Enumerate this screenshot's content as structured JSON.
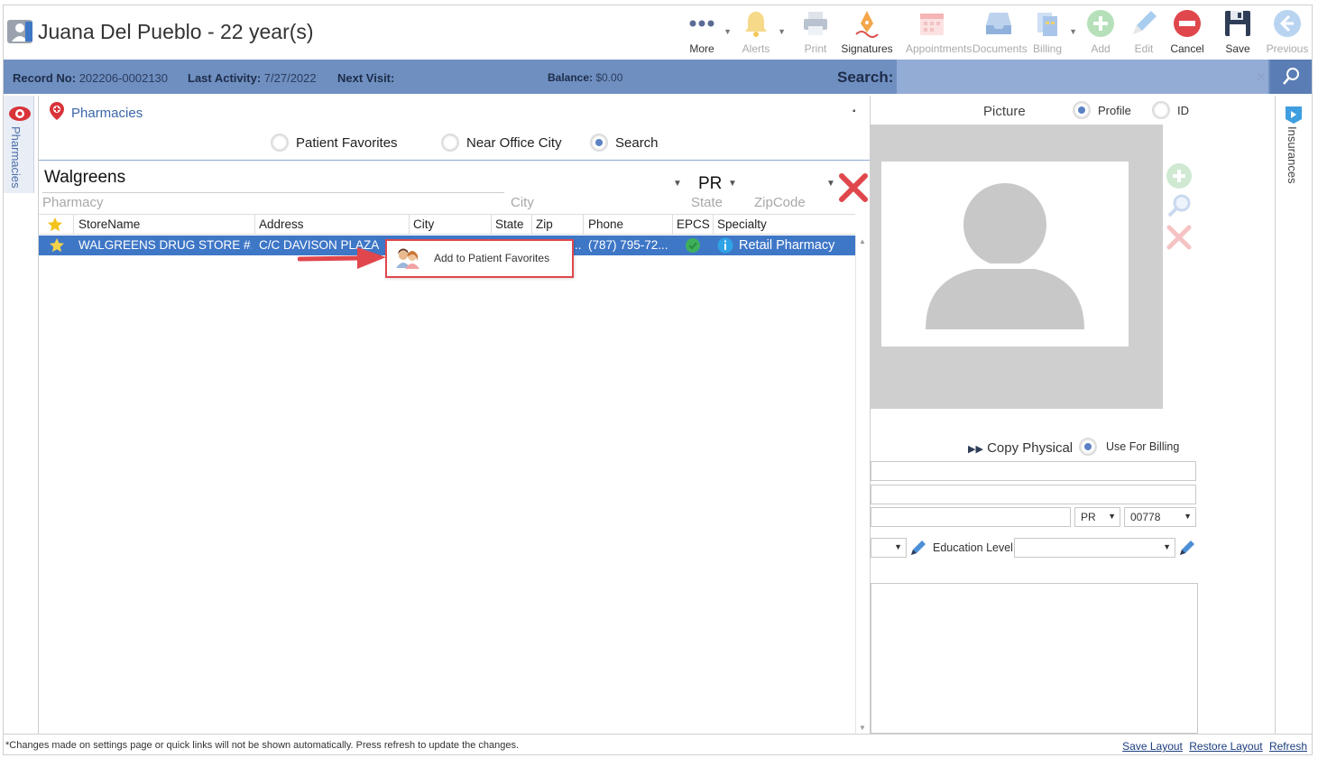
{
  "header": {
    "patient_title": "Juana Del Pueblo - 22 year(s)",
    "toolbar": [
      {
        "id": "more",
        "label": "More",
        "icon": "more-dots-icon",
        "enabled": true
      },
      {
        "id": "alerts",
        "label": "Alerts",
        "icon": "bell-icon",
        "enabled": false
      },
      {
        "id": "print",
        "label": "Print",
        "icon": "printer-icon",
        "enabled": false
      },
      {
        "id": "signatures",
        "label": "Signatures",
        "icon": "pen-nib-icon",
        "enabled": true
      },
      {
        "id": "appointments",
        "label": "Appointments",
        "icon": "calendar-icon",
        "enabled": false
      },
      {
        "id": "documents",
        "label": "Documents",
        "icon": "inbox-tray-icon",
        "enabled": false
      },
      {
        "id": "billing",
        "label": "Billing",
        "icon": "billing-docs-icon",
        "enabled": false
      },
      {
        "id": "add",
        "label": "Add",
        "icon": "plus-circle-icon",
        "enabled": false
      },
      {
        "id": "edit",
        "label": "Edit",
        "icon": "pencil-icon",
        "enabled": false
      },
      {
        "id": "cancel",
        "label": "Cancel",
        "icon": "minus-circle-icon",
        "enabled": true
      },
      {
        "id": "save",
        "label": "Save",
        "icon": "floppy-disk-icon",
        "enabled": true
      },
      {
        "id": "previous",
        "label": "Previous",
        "icon": "arrow-left-circle-icon",
        "enabled": false
      }
    ]
  },
  "infobar": {
    "record_label": "Record No:",
    "record_value": "202206-0002130",
    "activity_label": "Last Activity:",
    "activity_value": "7/27/2022",
    "next_visit_label": "Next Visit:",
    "balance_label": "Balance:",
    "balance_value": "$0.00",
    "search_label": "Search:",
    "search_value": ""
  },
  "left_tab": {
    "label": "Pharmacies"
  },
  "pharmacies": {
    "title": "Pharmacies",
    "modes": [
      {
        "label": "Patient Favorites",
        "selected": false
      },
      {
        "label": "Near Office City",
        "selected": false
      },
      {
        "label": "Search",
        "selected": true
      }
    ],
    "filters": {
      "pharmacy_value": "Walgreens",
      "pharmacy_label": "Pharmacy",
      "city_label": "City",
      "state_value": "PR",
      "state_label": "State",
      "zip_label": "ZipCode"
    },
    "columns": [
      "StoreName",
      "Address",
      "City",
      "State",
      "Zip",
      "Phone",
      "EPCS",
      "Specialty"
    ],
    "rows": [
      {
        "store": "WALGREENS DRUG STORE #...",
        "address": "C/C DAVISON PLAZA",
        "city": "",
        "state": "",
        "zip": "..",
        "phone": "(787) 795-72...",
        "specialty": "Retail Pharmacy"
      }
    ],
    "context_menu": {
      "label": "Add to Patient Favorites"
    }
  },
  "right_panel": {
    "picture_label": "Picture",
    "profile_label": "Profile",
    "id_label": "ID",
    "copy_physical": "Copy Physical",
    "use_for_billing": "Use For Billing",
    "state_select": "PR",
    "zip_select": "00778",
    "education_label": "Education Level:",
    "education_value": ""
  },
  "right_tab": {
    "label": "Insurances"
  },
  "footer": {
    "note": "*Changes made on settings page or quick links will not be shown automatically. Press refresh to update the changes.",
    "links": [
      "Save Layout",
      "Restore Layout",
      "Refresh"
    ]
  },
  "colors": {
    "infobar": "#6f8fc1",
    "selected_row": "#3f77c7",
    "accent_blue": "#3a66a8",
    "danger_red": "#e0474c"
  }
}
